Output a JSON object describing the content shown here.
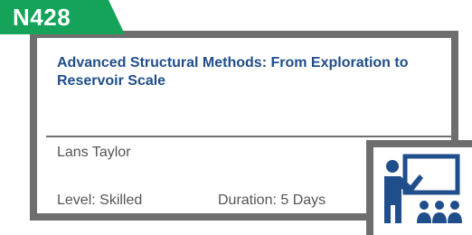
{
  "course": {
    "code": "N428",
    "title": "Advanced Structural Methods: From Exploration to Reservoir Scale",
    "instructor": "Lans Taylor",
    "level": "Level: Skilled",
    "duration": "Duration: 5 Days"
  },
  "icons": {
    "presentation": "classroom-presentation-icon"
  },
  "colors": {
    "code_tab": "#15a35a",
    "title": "#1f4e8a",
    "border": "#6e6e6e",
    "icon": "#1f4e8a",
    "text": "#555555"
  }
}
